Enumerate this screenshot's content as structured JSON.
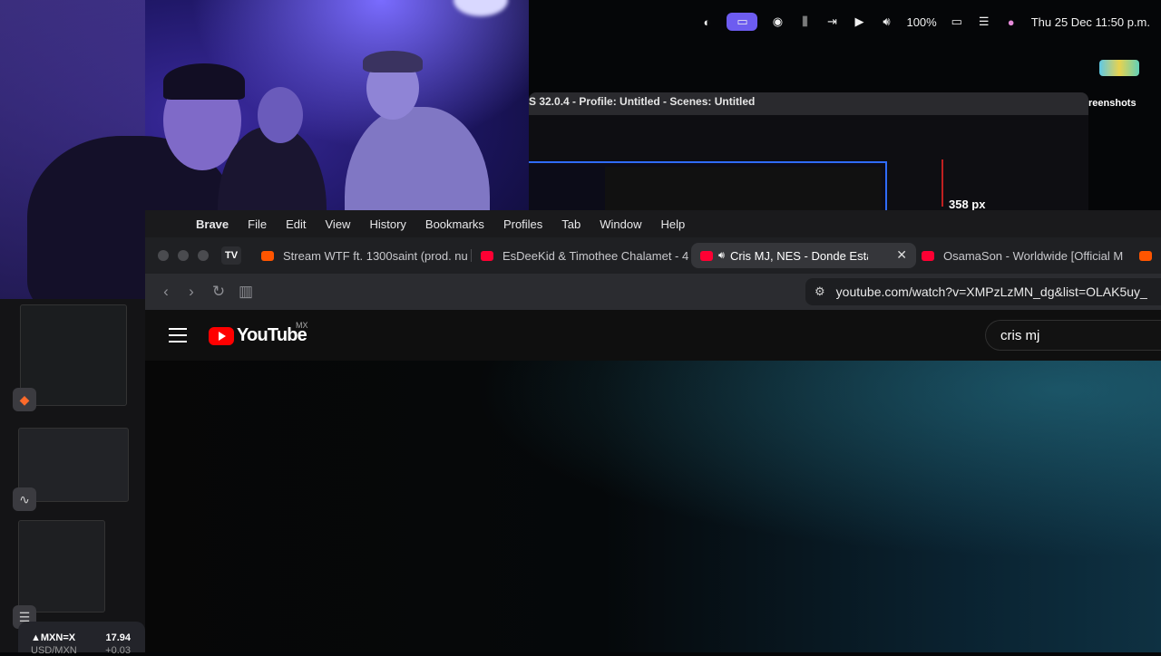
{
  "system_bar": {
    "battery": "100%",
    "datetime": "Thu 25 Dec  11:50 p.m."
  },
  "desktop": {
    "screenshots_label": "reenshots"
  },
  "obs": {
    "title": "S 32.0.4 - Profile: Untitled - Scenes: Untitled",
    "ruler_label": "358 px"
  },
  "app_menu": {
    "app": "Brave",
    "items": [
      "File",
      "Edit",
      "View",
      "History",
      "Bookmarks",
      "Profiles",
      "Tab",
      "Window",
      "Help"
    ]
  },
  "tabs": [
    {
      "label": "Stream WTF ft. 1300saint (prod. nu",
      "favicon": "soundcloud",
      "color": "#ff5500"
    },
    {
      "label": "EsDeeKid & Timothee Chalamet - 4",
      "favicon": "youtube",
      "color": "#ff0033"
    },
    {
      "label": "Cris MJ, NES - Donde Estas",
      "favicon": "youtube",
      "color": "#ff0033",
      "active": true,
      "audio": true
    },
    {
      "label": "OsamaSon - Worldwide [Official M",
      "favicon": "youtube",
      "color": "#ff0033"
    },
    {
      "label": "",
      "favicon": "soundcloud",
      "color": "#ff5500"
    }
  ],
  "toolbar": {
    "url": "youtube.com/watch?v=XMPzLzMN_dg&list=OLAK5uy_"
  },
  "youtube": {
    "wordmark": "YouTube",
    "country": "MX",
    "search_value": "cris mj"
  },
  "ticker": {
    "symbol": "▲MXN=X",
    "value": "17.94",
    "pair": "USD/MXN",
    "change": "+0.03"
  }
}
